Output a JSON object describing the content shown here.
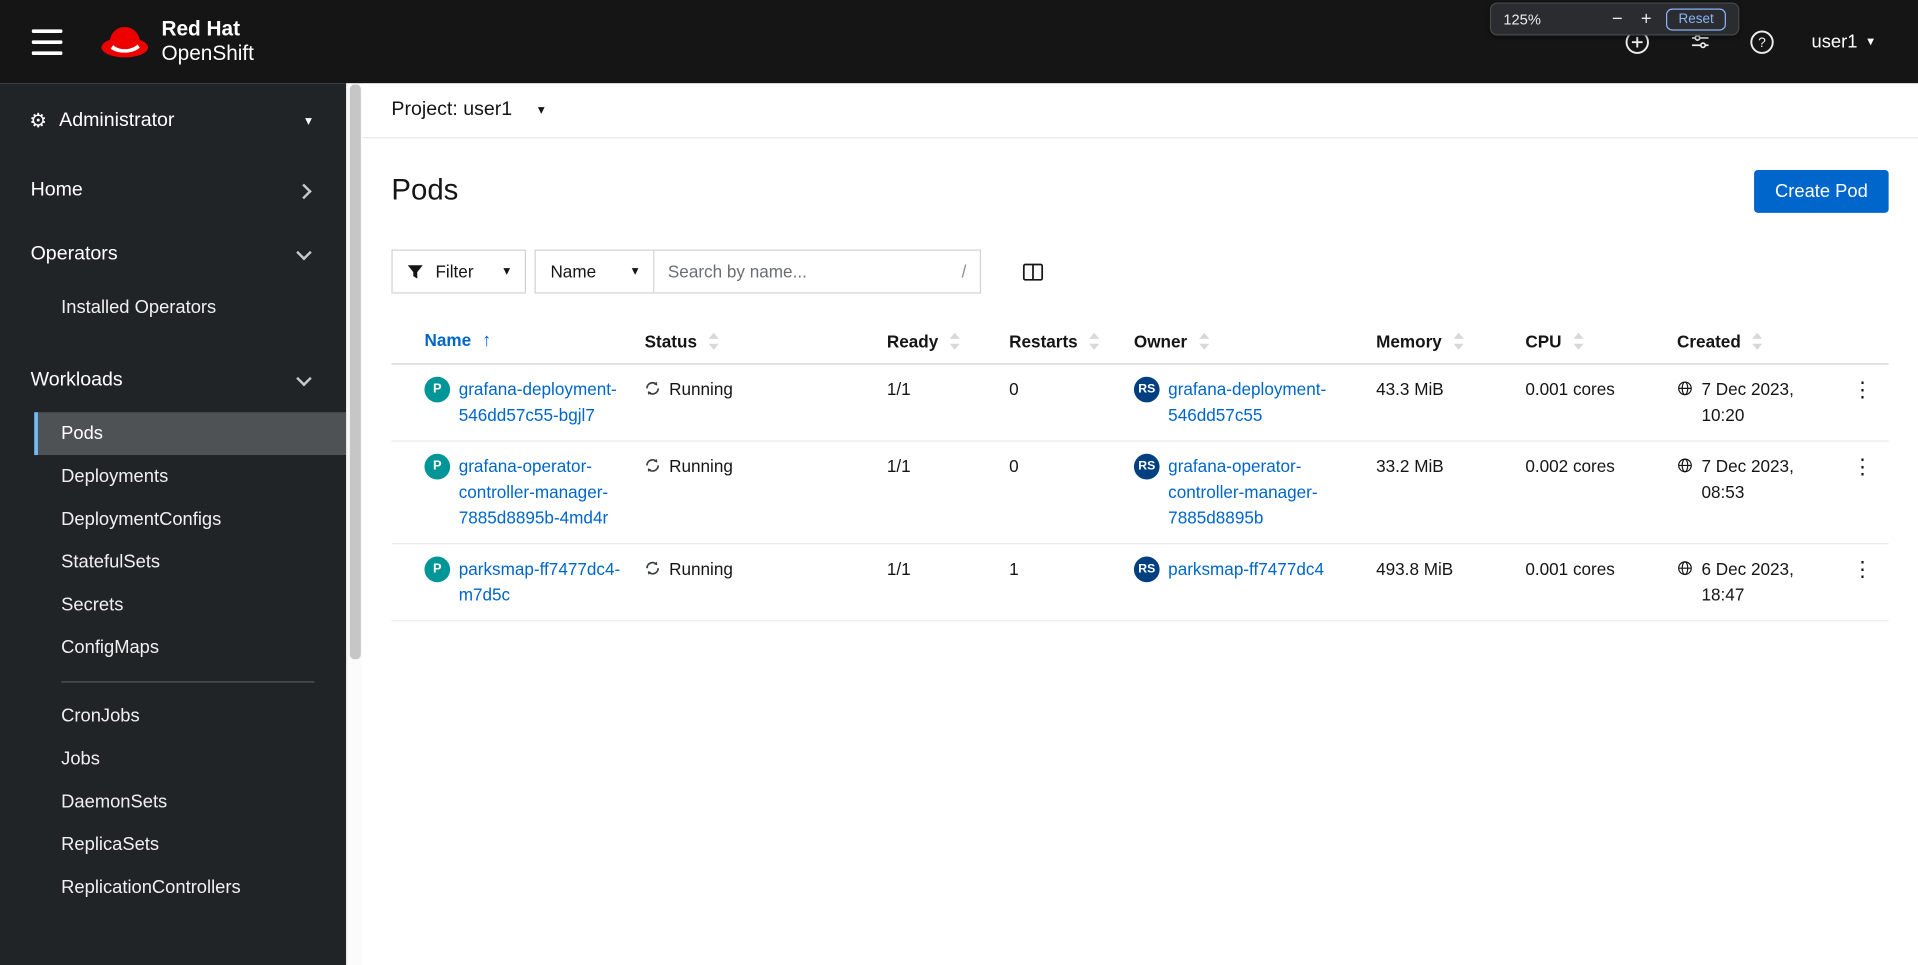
{
  "masthead": {
    "brand_line1": "Red Hat",
    "brand_line2": "OpenShift",
    "user": "user1",
    "zoom_popup": {
      "level": "125%",
      "zoom_out": "−",
      "zoom_in": "+",
      "reset": "Reset"
    }
  },
  "icons": {
    "caret_down": "▾",
    "gear": "⚙",
    "sort_asc": "↑",
    "kebab": "⋮"
  },
  "sidebar": {
    "perspective": "Administrator",
    "home": "Home",
    "operators": "Operators",
    "installed_operators": "Installed Operators",
    "workloads": "Workloads",
    "workloads_items": [
      "Pods",
      "Deployments",
      "DeploymentConfigs",
      "StatefulSets",
      "Secrets",
      "ConfigMaps",
      "CronJobs",
      "Jobs",
      "DaemonSets",
      "ReplicaSets",
      "ReplicationControllers"
    ],
    "active_item": "Pods"
  },
  "project_bar": {
    "selector": "Project: user1"
  },
  "page": {
    "title": "Pods",
    "create_button": "Create Pod"
  },
  "toolbar": {
    "filter": "Filter",
    "search_attribute": "Name",
    "search_placeholder": "Search by name...",
    "shortcut_hint": "/"
  },
  "table": {
    "columns": [
      "Name",
      "Status",
      "Ready",
      "Restarts",
      "Owner",
      "Memory",
      "CPU",
      "Created"
    ],
    "sorted_by": "Name",
    "sort_direction": "ascending",
    "rows": [
      {
        "badge": "P",
        "name": "grafana-deployment-546dd57c55-bgjl7",
        "status": "Running",
        "ready": "1/1",
        "restarts": "0",
        "owner_badge": "RS",
        "owner": "grafana-deployment-546dd57c55",
        "memory": "43.3 MiB",
        "cpu": "0.001 cores",
        "created": "7 Dec 2023, 10:20"
      },
      {
        "badge": "P",
        "name": "grafana-operator-controller-manager-7885d8895b-4md4r",
        "status": "Running",
        "ready": "1/1",
        "restarts": "0",
        "owner_badge": "RS",
        "owner": "grafana-operator-controller-manager-7885d8895b",
        "memory": "33.2 MiB",
        "cpu": "0.002 cores",
        "created": "7 Dec 2023, 08:53"
      },
      {
        "badge": "P",
        "name": "parksmap-ff7477dc4-m7d5c",
        "status": "Running",
        "ready": "1/1",
        "restarts": "1",
        "owner_badge": "RS",
        "owner": "parksmap-ff7477dc4",
        "memory": "493.8 MiB",
        "cpu": "0.001 cores",
        "created": "6 Dec 2023, 18:47"
      }
    ]
  },
  "colors": {
    "masthead_bg": "#151515",
    "sidebar_bg": "#212427",
    "active_nav_bg": "#4f5255",
    "active_nav_border": "#73bcf7",
    "primary_blue": "#0066cc",
    "link_blue": "#0066cc",
    "pod_badge": "#009596",
    "replicaset_badge": "#004080"
  }
}
